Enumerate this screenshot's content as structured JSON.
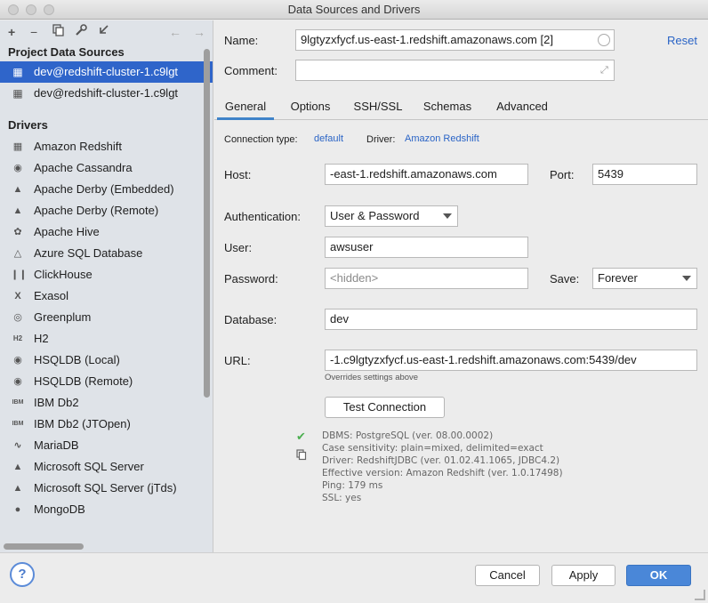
{
  "window": {
    "title": "Data Sources and Drivers"
  },
  "toolbar": {
    "add": "+",
    "remove": "−"
  },
  "sidebar": {
    "project_title": "Project Data Sources",
    "project_items": [
      {
        "label": "dev@redshift-cluster-1.c9lgt",
        "icon": "redshift-icon"
      },
      {
        "label": "dev@redshift-cluster-1.c9lgt",
        "icon": "redshift-icon"
      }
    ],
    "drivers_title": "Drivers",
    "drivers": [
      {
        "label": "Amazon Redshift",
        "icon": "redshift-icon"
      },
      {
        "label": "Apache Cassandra",
        "icon": "cassandra-icon"
      },
      {
        "label": "Apache Derby (Embedded)",
        "icon": "derby-icon"
      },
      {
        "label": "Apache Derby (Remote)",
        "icon": "derby-icon"
      },
      {
        "label": "Apache Hive",
        "icon": "hive-icon"
      },
      {
        "label": "Azure SQL Database",
        "icon": "azure-icon"
      },
      {
        "label": "ClickHouse",
        "icon": "clickhouse-icon"
      },
      {
        "label": "Exasol",
        "icon": "exasol-icon"
      },
      {
        "label": "Greenplum",
        "icon": "greenplum-icon"
      },
      {
        "label": "H2",
        "icon": "h2-icon"
      },
      {
        "label": "HSQLDB (Local)",
        "icon": "hsqldb-icon"
      },
      {
        "label": "HSQLDB (Remote)",
        "icon": "hsqldb-icon"
      },
      {
        "label": "IBM Db2",
        "icon": "ibm-icon"
      },
      {
        "label": "IBM Db2 (JTOpen)",
        "icon": "ibm-icon"
      },
      {
        "label": "MariaDB",
        "icon": "mariadb-icon"
      },
      {
        "label": "Microsoft SQL Server",
        "icon": "sqlserver-icon"
      },
      {
        "label": "Microsoft SQL Server (jTds)",
        "icon": "sqlserver-icon"
      },
      {
        "label": "MongoDB",
        "icon": "mongodb-icon"
      }
    ]
  },
  "form": {
    "name_label": "Name:",
    "name_value": "9lgtyzxfycf.us-east-1.redshift.amazonaws.com [2]",
    "reset_label": "Reset",
    "comment_label": "Comment:",
    "comment_value": "",
    "tabs": [
      "General",
      "Options",
      "SSH/SSL",
      "Schemas",
      "Advanced"
    ],
    "active_tab": "General",
    "connection_type_label": "Connection type:",
    "connection_type_value": "default",
    "driver_label": "Driver:",
    "driver_value": "Amazon Redshift",
    "host_label": "Host:",
    "host_value": "-east-1.redshift.amazonaws.com",
    "port_label": "Port:",
    "port_value": "5439",
    "auth_label": "Authentication:",
    "auth_value": "User & Password",
    "user_label": "User:",
    "user_value": "awsuser",
    "password_label": "Password:",
    "password_placeholder": "<hidden>",
    "save_label": "Save:",
    "save_value": "Forever",
    "database_label": "Database:",
    "database_value": "dev",
    "url_label": "URL:",
    "url_value": "-1.c9lgtyzxfycf.us-east-1.redshift.amazonaws.com:5439/dev",
    "url_hint": "Overrides settings above",
    "test_button": "Test Connection",
    "status_lines": [
      "DBMS: PostgreSQL (ver. 08.00.0002)",
      "Case sensitivity: plain=mixed, delimited=exact",
      "Driver: RedshiftJDBC (ver. 01.02.41.1065, JDBC4.2)",
      "Effective version: Amazon Redshift (ver. 1.0.17498)",
      "Ping: 179 ms",
      "SSL: yes"
    ]
  },
  "footer": {
    "help": "?",
    "cancel": "Cancel",
    "apply": "Apply",
    "ok": "OK"
  },
  "colors": {
    "selection": "#2f65ca",
    "link": "#2a64c6",
    "primary_button": "#4a87d8",
    "success": "#4caf50"
  }
}
